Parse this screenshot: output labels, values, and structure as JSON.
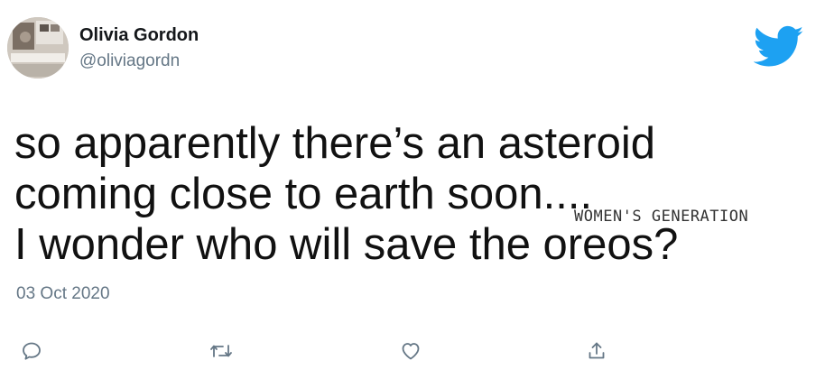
{
  "tweet": {
    "author": {
      "name": "Olivia Gordon",
      "handle": "@oliviagordn"
    },
    "text_lines": [
      "so apparently there’s an asteroid",
      "coming close to earth soon....",
      "I wonder who will save the oreos?"
    ],
    "timestamp": "03 Oct 2020",
    "watermark": "WOMEN'S GENERATION"
  },
  "icons": {
    "brand": "twitter-bird-icon",
    "actions": [
      "reply-icon",
      "retweet-icon",
      "like-icon",
      "share-icon"
    ]
  },
  "colors": {
    "brand_blue": "#1da1f2",
    "secondary_text": "#657786",
    "primary_text": "#14171a"
  }
}
